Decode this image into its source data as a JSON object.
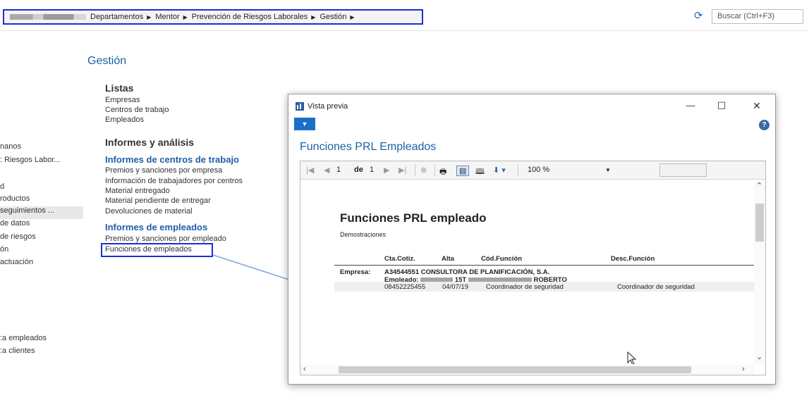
{
  "breadcrumb": {
    "items": [
      "Departamentos",
      "Mentor",
      "Prevención de Riesgos Laborales",
      "Gestión"
    ]
  },
  "search": {
    "placeholder": "Buscar (Ctrl+F3)"
  },
  "leftnav": {
    "items": [
      "nanos",
      ": Riesgos Labor...",
      "d",
      "roductos",
      "seguimientos ...",
      "de datos",
      "de riesgos",
      "ón",
      "actuación",
      ":a empleados",
      ":a clientes"
    ]
  },
  "main": {
    "title": "Gestión",
    "listas": {
      "heading": "Listas",
      "items": [
        "Empresas",
        "Centros de trabajo",
        "Empleados"
      ]
    },
    "informes": {
      "heading": "Informes y análisis"
    },
    "centros": {
      "heading": "Informes de centros de trabajo",
      "items": [
        "Premios y sanciones por empresa",
        "Información de trabajadores por centros",
        "Material entregado",
        "Material pendiente de entregar",
        "Devoluciones de material"
      ]
    },
    "empleados": {
      "heading": "Informes de empleados",
      "items": [
        "Premios y sanciones por empleado",
        "Funciones de empleados"
      ]
    }
  },
  "preview": {
    "window_title": "Vista previa",
    "heading": "Funciones PRL Empleados",
    "toolbar": {
      "page": "1",
      "of_label": "de",
      "total_pages": "1",
      "zoom": "100 %"
    },
    "report": {
      "title": "Funciones PRL empleado",
      "subtitle": "Demostraciones",
      "columns": [
        "Cta.Cotiz.",
        "Alta",
        "Cód.Función",
        "Desc.Función"
      ],
      "empresa_label": "Empresa:",
      "empresa_value": "A34544551 CONSULTORA DE PLANIFICACIÓN, S.A.",
      "empleado_label": "Empleado:",
      "empleado_code": "15T",
      "empleado_name": "ROBERTO",
      "row": {
        "cta_cotiz": "08452225455",
        "alta": "04/07/19",
        "cod_funcion": "Coordinador de seguridad",
        "desc_funcion": "Coordinador de seguridad"
      }
    }
  }
}
